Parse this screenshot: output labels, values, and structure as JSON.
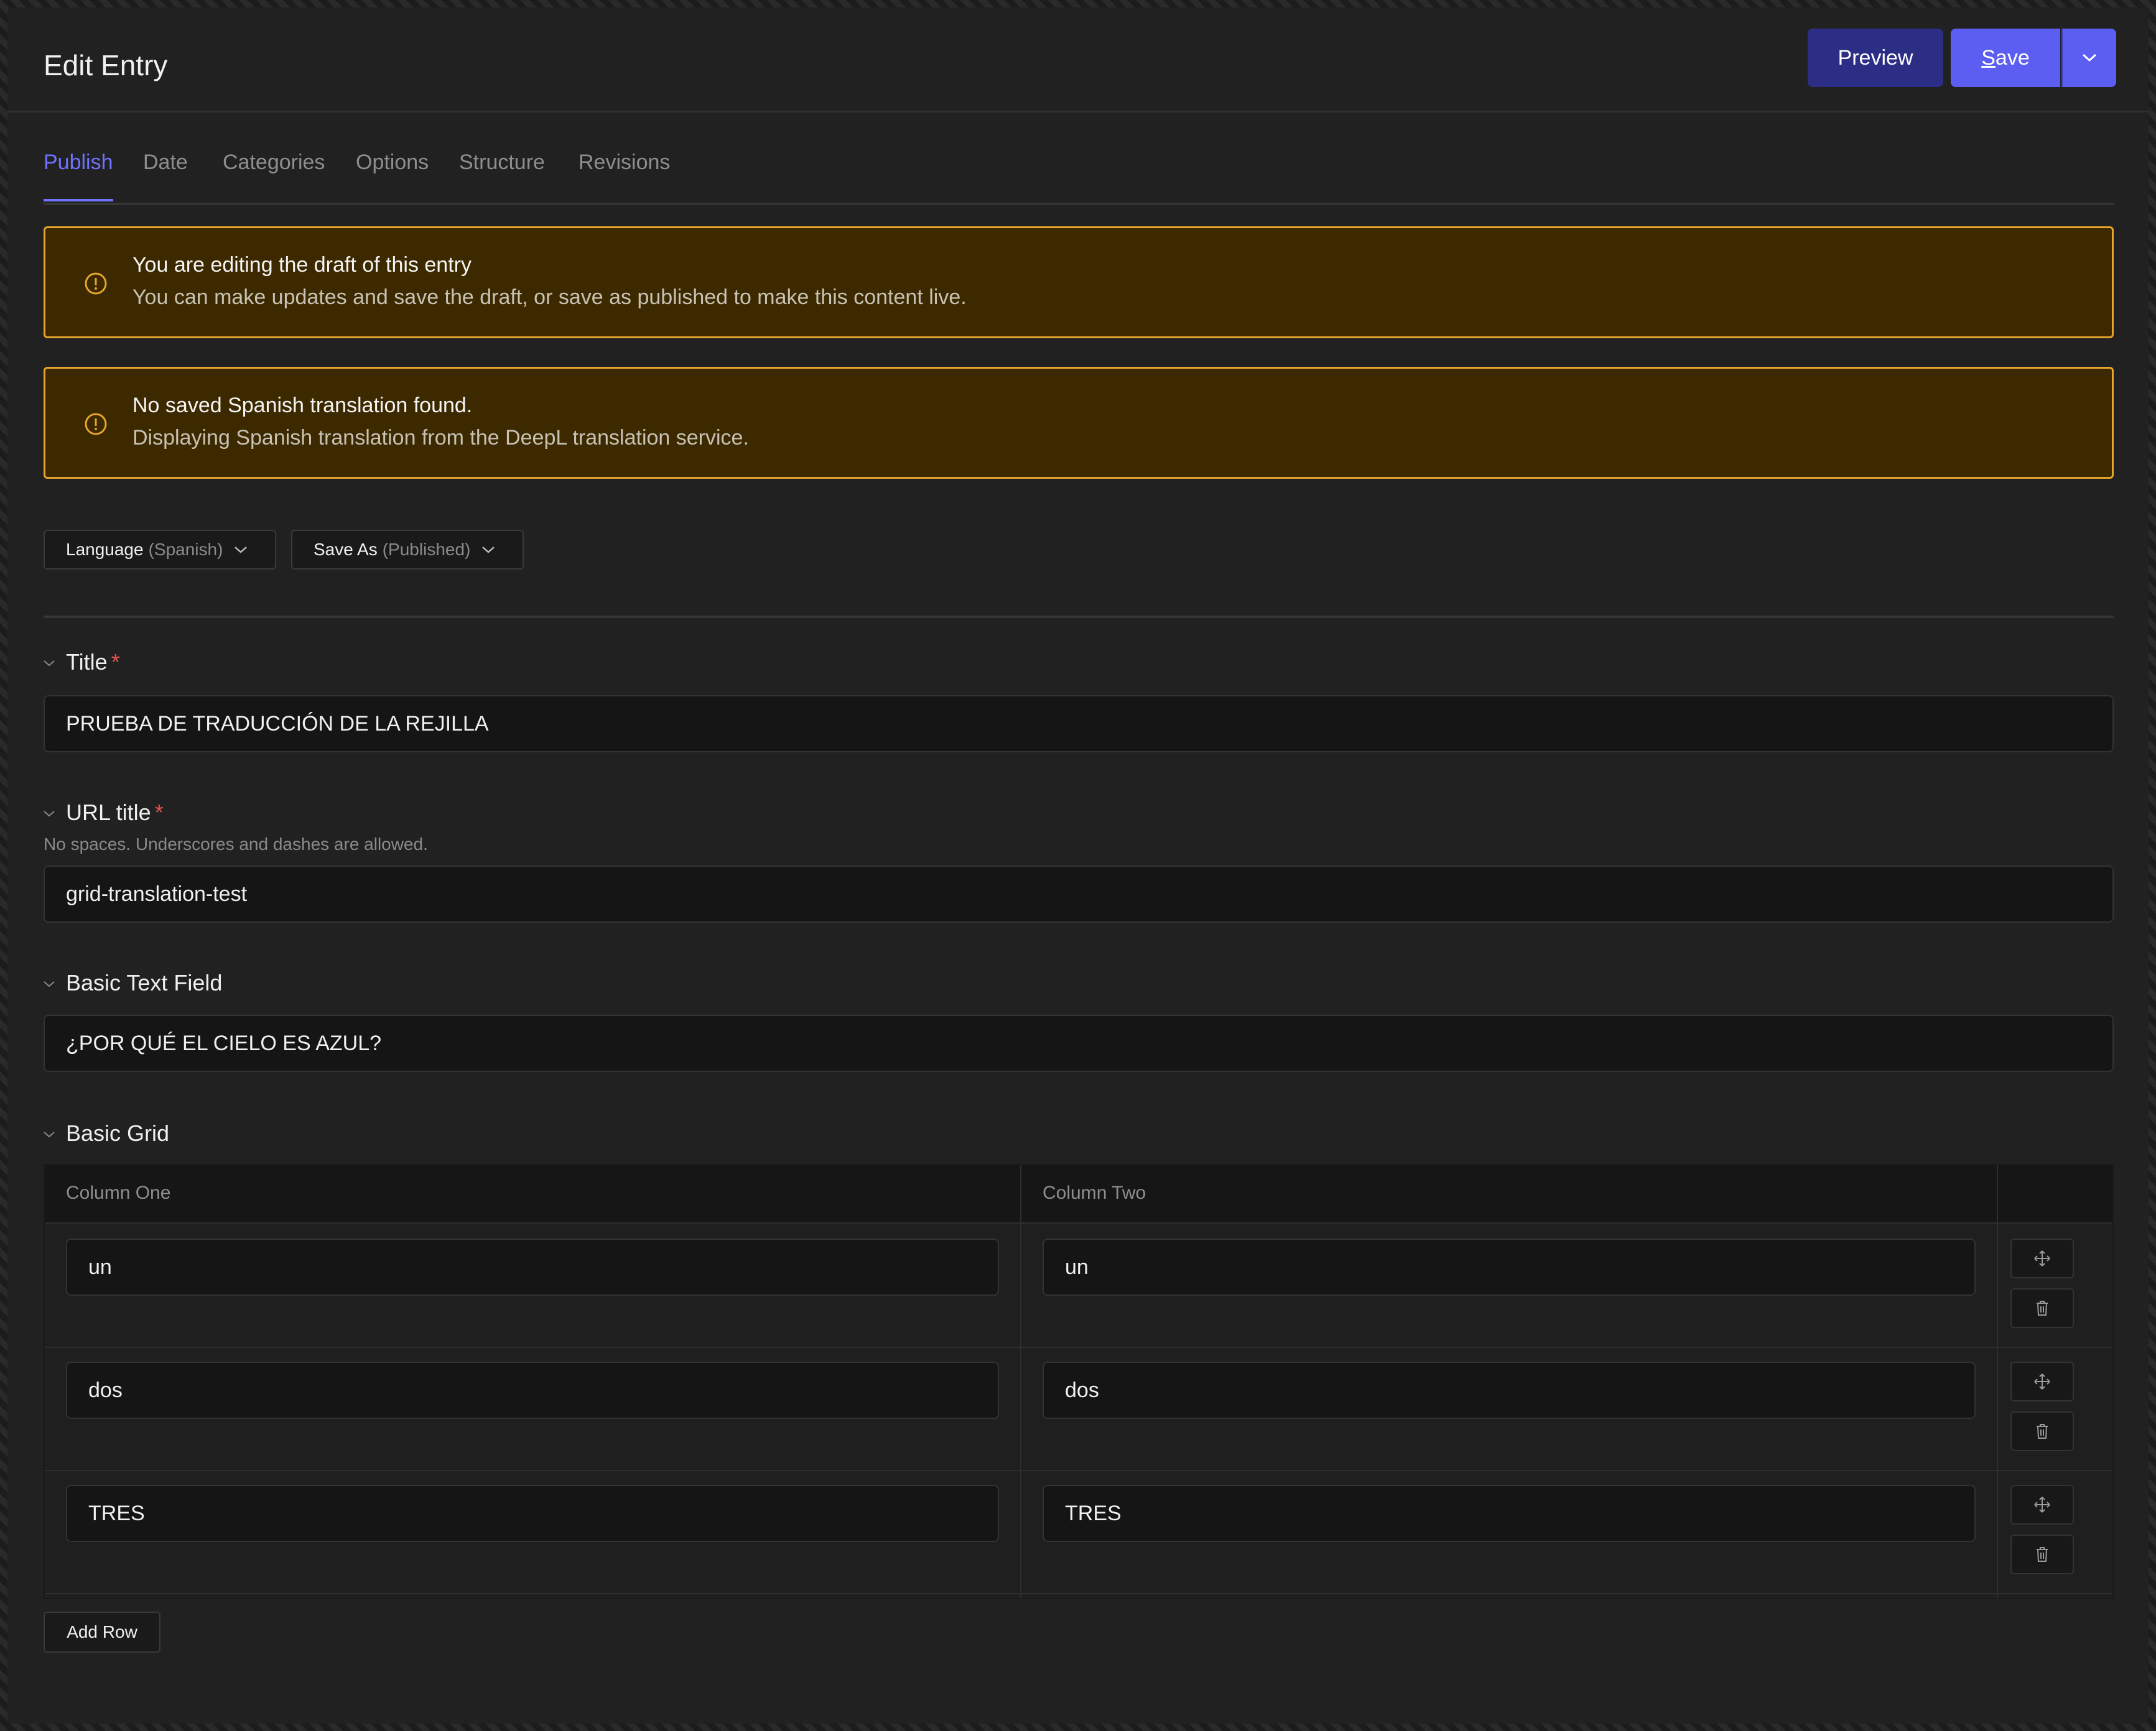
{
  "header": {
    "title": "Edit Entry",
    "preview_label": "Preview",
    "save_first_letter": "S",
    "save_rest": "ave"
  },
  "tabs": [
    {
      "label": "Publish",
      "active": true
    },
    {
      "label": "Date"
    },
    {
      "label": "Categories"
    },
    {
      "label": "Options"
    },
    {
      "label": "Structure"
    },
    {
      "label": "Revisions"
    }
  ],
  "alerts": [
    {
      "title": "You are editing the draft of this entry",
      "body": "You can make updates and save the draft, or save as published to make this content live.",
      "icon": "alert-circle-icon"
    },
    {
      "title": "No saved Spanish translation found.",
      "body": "Displaying Spanish translation from the DeepL translation service.",
      "icon": "alert-circle-icon"
    }
  ],
  "controls": {
    "language": {
      "label": "Language",
      "value": "(Spanish)"
    },
    "save_as": {
      "label": "Save As",
      "value": "(Published)"
    }
  },
  "fields": {
    "title": {
      "label": "Title",
      "required": "*",
      "value": "PRUEBA DE TRADUCCIÓN DE LA REJILLA"
    },
    "url_title": {
      "label": "URL title",
      "required": "*",
      "hint": "No spaces. Underscores and dashes are allowed.",
      "value": "grid-translation-test"
    },
    "basic_text": {
      "label": "Basic Text Field",
      "value": "¿POR QUÉ EL CIELO ES AZUL?"
    },
    "basic_grid": {
      "label": "Basic Grid",
      "columns": [
        "Column One",
        "Column Two"
      ],
      "rows": [
        [
          "un",
          "un"
        ],
        [
          "dos",
          "dos"
        ],
        [
          "TRES",
          "TRES"
        ]
      ],
      "add_row_label": "Add Row"
    }
  },
  "colors": {
    "accent": "#5b5ef0",
    "preview_bg": "#2c2e85",
    "alert_bg": "#3d2900",
    "alert_border": "#e6a52b",
    "required": "#e05252"
  }
}
